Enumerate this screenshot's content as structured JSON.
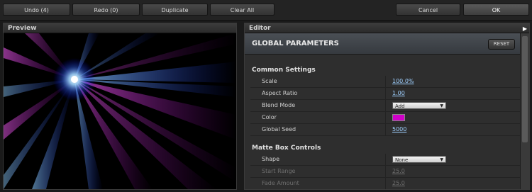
{
  "toolbar": {
    "undo": "Undo (4)",
    "redo": "Redo (0)",
    "duplicate": "Duplicate",
    "clear_all": "Clear All",
    "cancel": "Cancel",
    "ok": "OK"
  },
  "preview": {
    "title": "Preview"
  },
  "editor": {
    "title": "Editor",
    "expand_icon": "triangle-right-icon",
    "global_title": "GLOBAL PARAMETERS",
    "reset_label": "RESET",
    "common": {
      "heading": "Common Settings",
      "scale_label": "Scale",
      "scale_value": "100.0%",
      "aspect_label": "Aspect Ratio",
      "aspect_value": "1.00",
      "blend_label": "Blend Mode",
      "blend_value": "Add",
      "color_label": "Color",
      "color_value": "#d000c8",
      "seed_label": "Global Seed",
      "seed_value": "5000"
    },
    "matte": {
      "heading": "Matte Box Controls",
      "shape_label": "Shape",
      "shape_value": "None",
      "start_label": "Start Range",
      "start_value": "25.0",
      "fade_label": "Fade Amount",
      "fade_value": "25.0"
    }
  }
}
